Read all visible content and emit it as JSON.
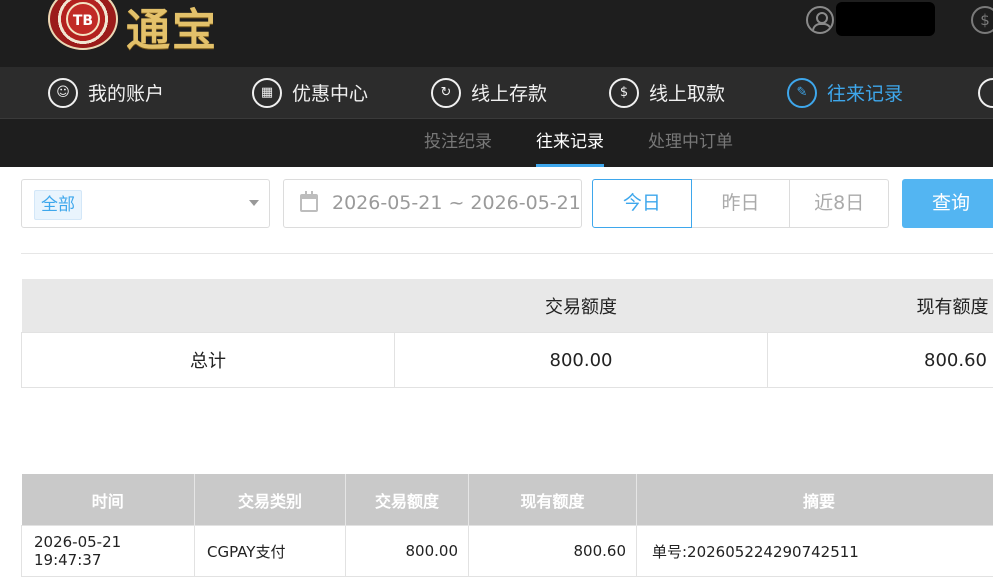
{
  "brand": {
    "logo_chip_text": "TB",
    "logo_text": "通宝"
  },
  "header": {
    "coin_icon_text": "$"
  },
  "main_nav": {
    "items": [
      {
        "label": "我的账户",
        "icon": "user-icon"
      },
      {
        "label": "优惠中心",
        "icon": "gift-icon"
      },
      {
        "label": "线上存款",
        "icon": "deposit-icon"
      },
      {
        "label": "线上取款",
        "icon": "withdraw-icon"
      },
      {
        "label": "往来记录",
        "icon": "record-icon",
        "active": true
      }
    ]
  },
  "sub_nav": {
    "items": [
      {
        "label": "投注纪录"
      },
      {
        "label": "往来记录",
        "active": true
      },
      {
        "label": "处理中订单"
      }
    ]
  },
  "filter": {
    "type_tag": "全部",
    "date_range": "2026-05-21 ~ 2026-05-21",
    "ranges": [
      "今日",
      "昨日",
      "近8日"
    ],
    "active_range": "今日",
    "query_label": "查询"
  },
  "summary": {
    "headers": [
      "",
      "交易额度",
      "现有额度"
    ],
    "row": {
      "label": "总计",
      "amount": "800.00",
      "balance": "800.60"
    }
  },
  "detail": {
    "headers": [
      "时间",
      "交易类别",
      "交易额度",
      "现有额度",
      "摘要"
    ],
    "rows": [
      {
        "time": "2026-05-21 19:47:37",
        "category": "CGPAY支付",
        "amount": "800.00",
        "balance": "800.60",
        "memo": "单号:202605224290742511"
      }
    ]
  },
  "colors": {
    "accent": "#3ea7ec",
    "query_button": "#53b5f2",
    "topbar": "#1e1e1e",
    "nav": "#2c2c2c"
  }
}
